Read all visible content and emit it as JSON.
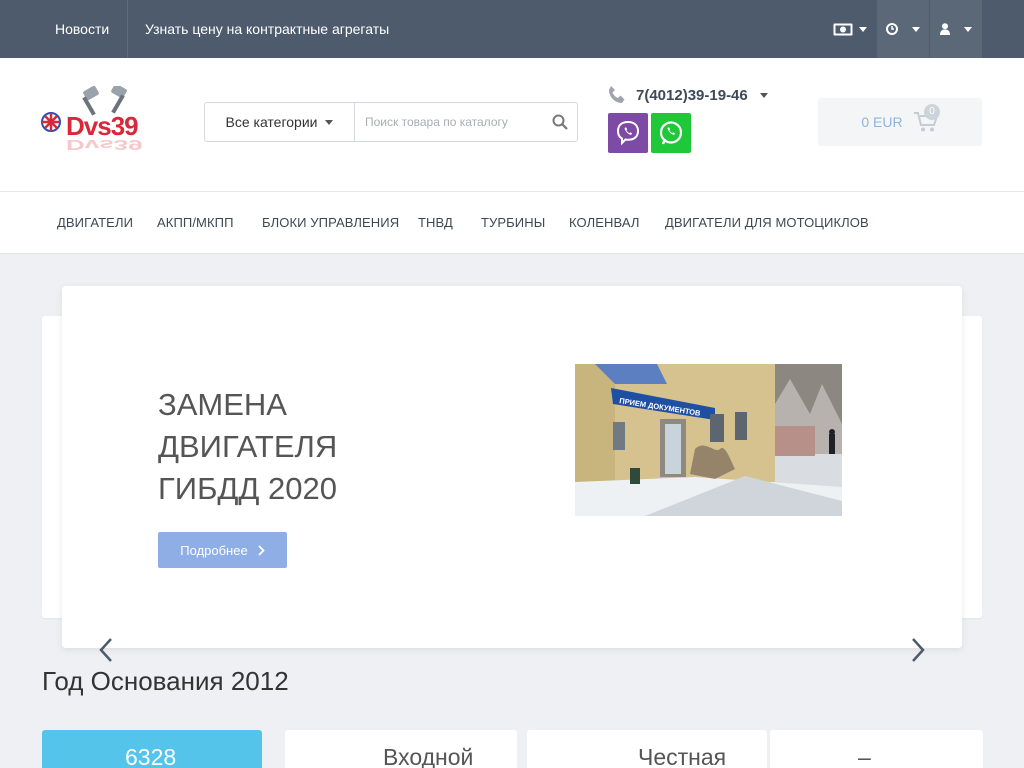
{
  "topbar": {
    "links": [
      "Новости",
      "Узнать цену на контрактные агрегаты"
    ]
  },
  "header": {
    "logo_text": "Dvs39",
    "search": {
      "category": "Все категории",
      "placeholder": "Поиск товара по каталогу"
    },
    "phone": "7(4012)39-19-46",
    "cart": {
      "total": "0 EUR",
      "count": "0"
    }
  },
  "nav": {
    "items": [
      "ДВИГАТЕЛИ",
      "АКПП/МКПП",
      "БЛОКИ УПРАВЛЕНИЯ",
      "ТНВД",
      "ТУРБИНЫ",
      "КОЛЕНВАЛ",
      "ДВИГАТЕЛИ ДЛЯ МОТОЦИКЛОВ"
    ]
  },
  "slider": {
    "title": "ЗАМЕНА ДВИГАТЕЛЯ ГИБДД 2020",
    "button": "Подробнее",
    "photo_sign": "ПРИЕМ ДОКУМЕНТОВ"
  },
  "section": {
    "title": "Год Основания 2012"
  },
  "cards": [
    "6328",
    "Входной",
    "Честная",
    "–"
  ],
  "colors": {
    "topbar": "#4d5b6c",
    "accent": "#55c4ea",
    "button": "#8faee5",
    "viber": "#7d4aa6",
    "whatsapp": "#1ec838"
  }
}
